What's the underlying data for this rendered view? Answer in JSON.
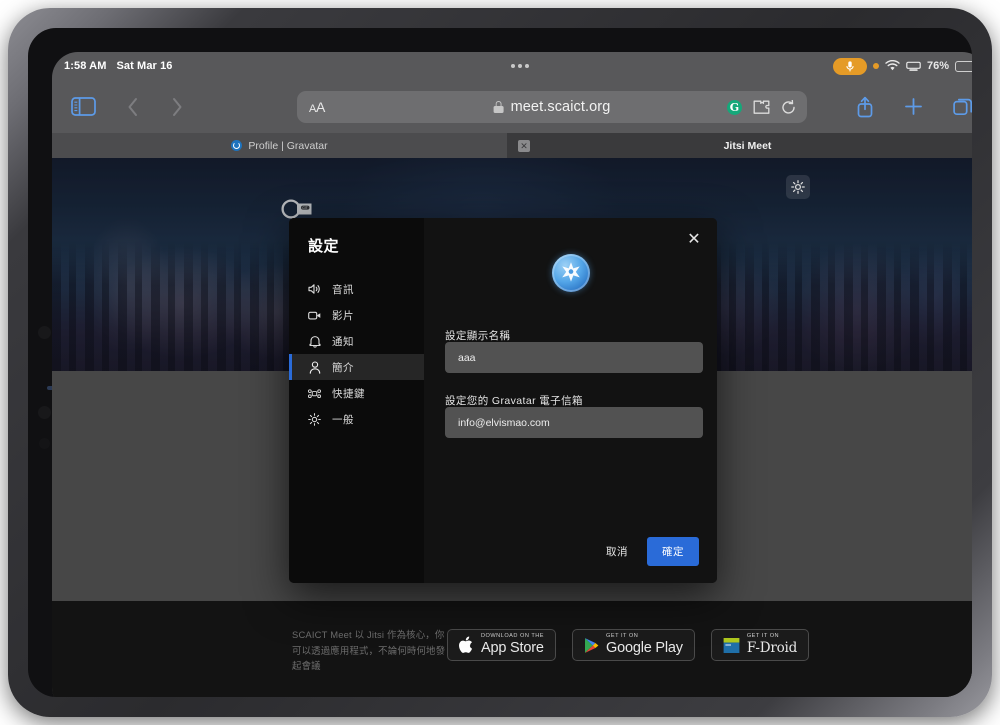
{
  "status_bar": {
    "time": "1:58 AM",
    "date": "Sat Mar 16",
    "battery_percent": "76%",
    "icons": [
      "microphone-active-pill",
      "orange-privacy-dot",
      "wifi-icon",
      "screen-mirroring-icon",
      "battery-icon"
    ]
  },
  "browser": {
    "name": "Safari",
    "toolbar": {
      "sidebar_toggle": "sidebar-toggle-icon",
      "back": "chevron-left-icon",
      "forward": "chevron-right-icon",
      "text_size_label": "AA",
      "share": "share-icon",
      "new_tab": "plus-icon",
      "tabs_overview": "tabs-icon"
    },
    "url_bar": {
      "url": "meet.scaict.org",
      "lock": "lock-icon",
      "extension_badge": "G",
      "extension_icon": "puzzle-extension-icon",
      "reload_icon": "reload-icon"
    },
    "tabs": [
      {
        "title": "Profile | Gravatar",
        "active": false,
        "favicon": "gravatar-icon"
      },
      {
        "title": "Jitsi Meet",
        "active": true,
        "close_label": "✕"
      }
    ]
  },
  "page": {
    "logo_name": "scaict-meet-logo",
    "settings_gear": "gear-icon",
    "footer": {
      "text": "SCAICT Meet 以 Jitsi 作為核心，你可以透過應用程式，不論何時何地發起會議",
      "badges": [
        {
          "sup": "Download on the",
          "main": "App Store",
          "icon": "apple-icon"
        },
        {
          "sup": "GET IT ON",
          "main": "Google Play",
          "icon": "google-play-icon"
        },
        {
          "sup": "GET IT ON",
          "main": "F-Droid",
          "icon": "fdroid-icon"
        }
      ]
    }
  },
  "settings_dialog": {
    "title": "設定",
    "close_label": "✕",
    "nav_items": [
      {
        "label": "音訊",
        "icon": "speaker-icon",
        "active": false
      },
      {
        "label": "影片",
        "icon": "video-camera-icon",
        "active": false
      },
      {
        "label": "通知",
        "icon": "bell-icon",
        "active": false
      },
      {
        "label": "簡介",
        "icon": "person-icon",
        "active": true
      },
      {
        "label": "快捷鍵",
        "icon": "keyboard-shortcut-icon",
        "active": false
      },
      {
        "label": "一般",
        "icon": "gear-icon",
        "active": false
      }
    ],
    "avatar_alt": "gravatar-avatar",
    "fields": {
      "display_name": {
        "label": "設定顯示名稱",
        "value": "aaa",
        "placeholder": "設定顯示名稱"
      },
      "gravatar_email": {
        "label": "設定您的 Gravatar 電子信箱",
        "value": "info@elvismao.com",
        "placeholder": "電子信箱"
      }
    },
    "cancel_label": "取消",
    "ok_label": "確定"
  },
  "colors": {
    "accent_blue": "#2a6bd8",
    "toolbar_blue": "#5d9be8",
    "chrome_gray": "#58585a",
    "modal_bg": "#121212",
    "input_bg": "#525252",
    "status_orange": "#e59b27"
  }
}
